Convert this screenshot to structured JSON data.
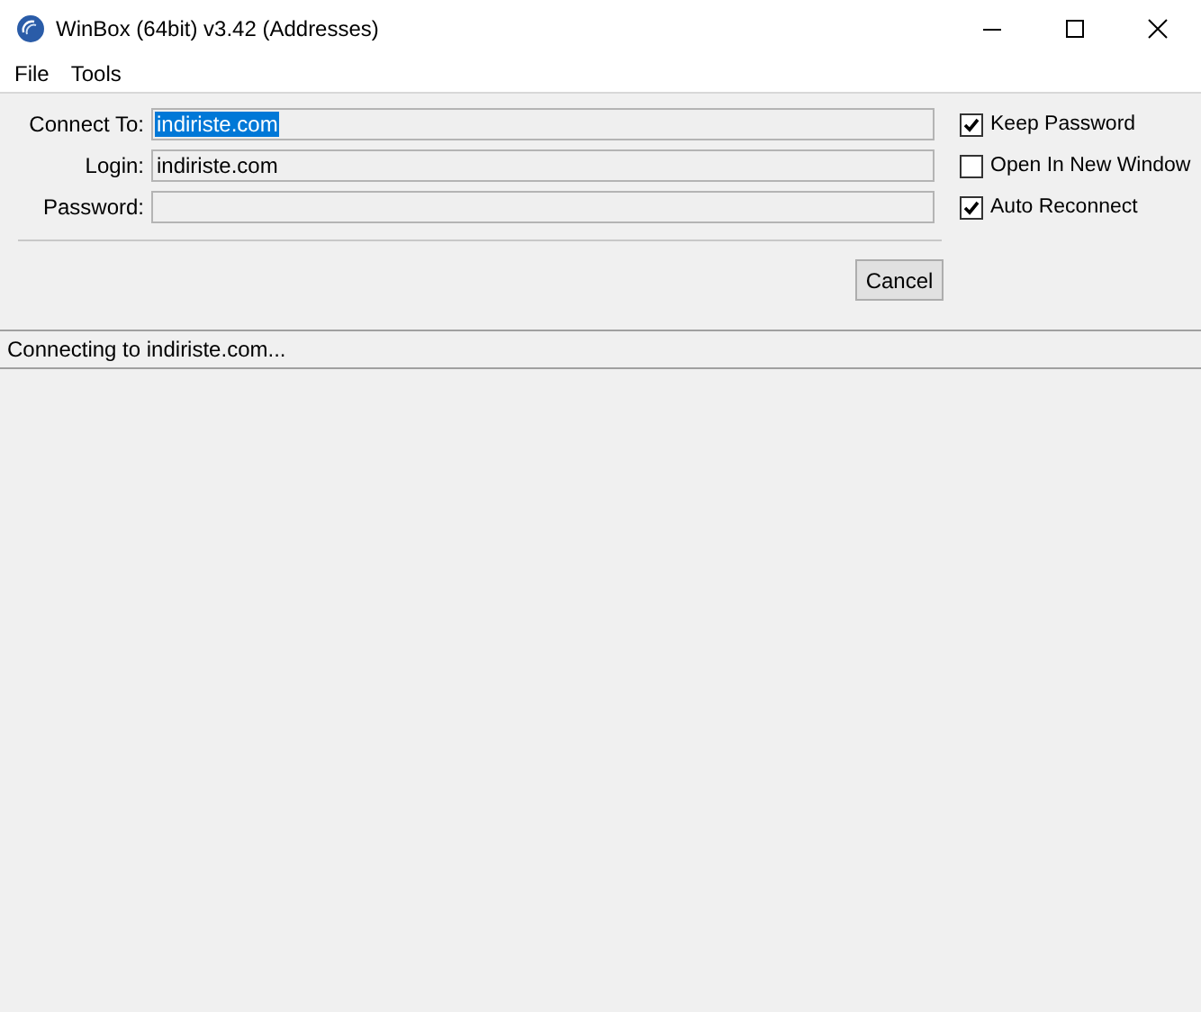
{
  "window": {
    "title": "WinBox (64bit) v3.42 (Addresses)"
  },
  "menu": [
    "File",
    "Tools"
  ],
  "fields": [
    {
      "label": "Connect To:",
      "value": "indiriste.com",
      "highlighted": true
    },
    {
      "label": "Login:",
      "value": "indiriste.com",
      "highlighted": false
    },
    {
      "label": "Password:"
    }
  ],
  "options": [
    {
      "label": "Keep Password",
      "checked": true
    },
    {
      "label": "Open In New Window",
      "checked": false
    },
    {
      "label": "Auto Reconnect",
      "checked": true
    }
  ],
  "buttons": [
    "Cancel"
  ],
  "status_bar": "Connecting to indiriste.com..."
}
